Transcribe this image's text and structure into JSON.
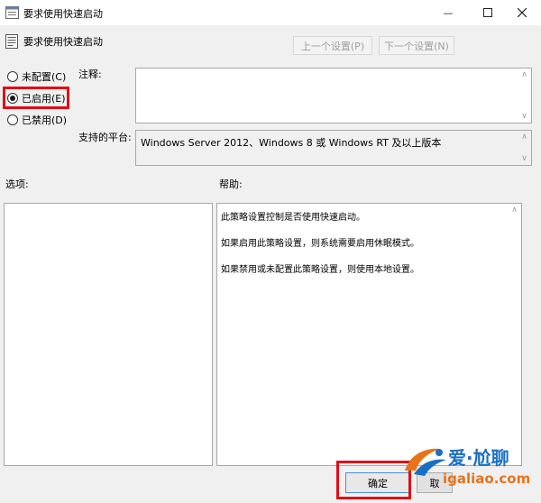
{
  "window": {
    "title": "要求使用快速启动"
  },
  "header": {
    "title": "要求使用快速启动",
    "prev_label": "上一个设置(P)",
    "next_label": "下一个设置(N)"
  },
  "state_options": [
    {
      "label": "未配置(C)",
      "selected": false
    },
    {
      "label": "已启用(E)",
      "selected": true
    },
    {
      "label": "已禁用(D)",
      "selected": false
    }
  ],
  "comment": {
    "label": "注释:",
    "value": ""
  },
  "supported": {
    "label": "支持的平台:",
    "value": "Windows Server 2012、Windows 8 或 Windows RT 及以上版本"
  },
  "options": {
    "label": "选项:"
  },
  "help": {
    "label": "帮助:",
    "lines": [
      "此策略设置控制是否使用快速启动。",
      "如果启用此策略设置，则系统需要启用休眠模式。",
      "如果禁用或未配置此策略设置，则使用本地设置。"
    ]
  },
  "buttons": {
    "ok": "确定",
    "cancel": "取"
  },
  "watermark": {
    "brand": "爱·尬聊",
    "url": "igaliao.com"
  },
  "colors": {
    "highlight": "#e30b17",
    "focus": "#4a8fd9",
    "brand_orange": "#e8731a",
    "brand_blue": "#1a6fc4"
  }
}
